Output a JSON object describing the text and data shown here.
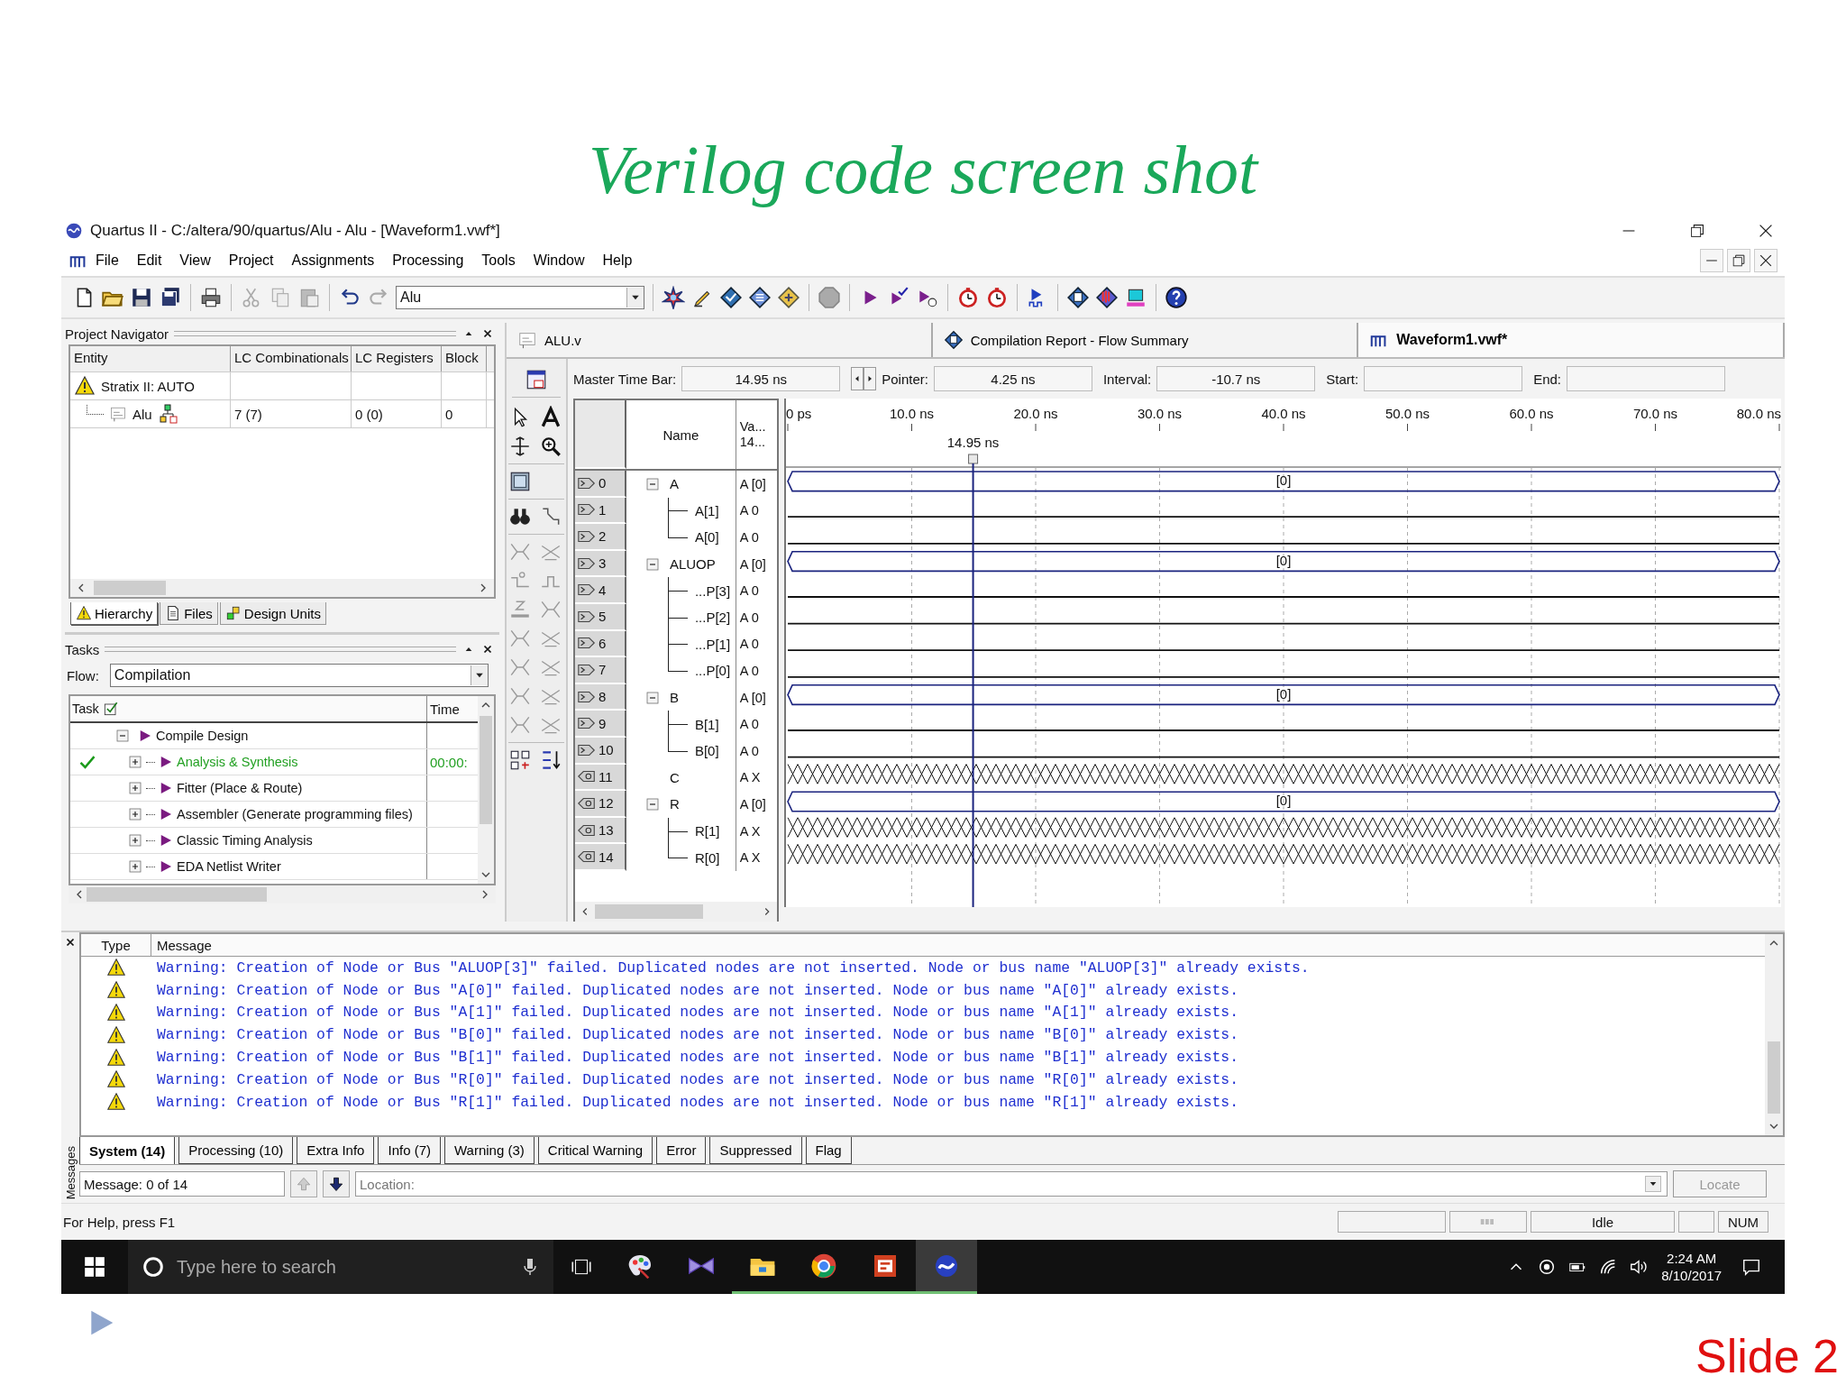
{
  "slide": {
    "title": "Verilog code screen shot",
    "footer": "Slide 2"
  },
  "window": {
    "title": "Quartus II - C:/altera/90/quartus/Alu - Alu - [Waveform1.vwf*]"
  },
  "menu": [
    "File",
    "Edit",
    "View",
    "Project",
    "Assignments",
    "Processing",
    "Tools",
    "Window",
    "Help"
  ],
  "toolbar": {
    "combo": "Alu"
  },
  "project_navigator": {
    "title": "Project Navigator",
    "columns": [
      "Entity",
      "LC Combinationals",
      "LC Registers",
      "Block"
    ],
    "rows": [
      {
        "entity": "Stratix II: AUTO",
        "kind": "device"
      },
      {
        "entity": "Alu",
        "kind": "module",
        "cells": [
          "7 (7)",
          "0 (0)",
          "0"
        ]
      }
    ],
    "tabs": [
      {
        "label": "Hierarchy",
        "kind": "hierarchy",
        "selected": true
      },
      {
        "label": "Files",
        "kind": "files",
        "selected": false
      },
      {
        "label": "Design Units",
        "kind": "units",
        "selected": false
      }
    ]
  },
  "tasks": {
    "title": "Tasks",
    "flow_label": "Flow:",
    "flow": "Compilation",
    "columns": [
      "Task",
      "Time"
    ],
    "items": [
      {
        "label": "Compile Design",
        "expanded": true,
        "children": [
          {
            "label": "Analysis & Synthesis",
            "done": true,
            "time": "00:00:",
            "expanded": false
          },
          {
            "label": "Fitter (Place & Route)",
            "done": false,
            "expanded": false
          },
          {
            "label": "Assembler (Generate programming files)",
            "done": false,
            "expanded": false
          },
          {
            "label": "Classic Timing Analysis",
            "done": false,
            "expanded": false
          },
          {
            "label": "EDA Netlist Writer",
            "done": false,
            "expanded": false
          }
        ]
      }
    ]
  },
  "doc_tabs": [
    {
      "label": "ALU.v",
      "kind": "verilog",
      "selected": false
    },
    {
      "label": "Compilation Report - Flow Summary",
      "kind": "report",
      "selected": false
    },
    {
      "label": "Waveform1.vwf*",
      "kind": "waveform",
      "selected": true
    }
  ],
  "time_bar": [
    {
      "label": "Master Time Bar:",
      "value": "14.95 ns",
      "arrows": true
    },
    {
      "label": "Pointer:",
      "value": "4.25 ns"
    },
    {
      "label": "Interval:",
      "value": "-10.7 ns"
    },
    {
      "label": "Start:"
    },
    {
      "label": "End:"
    }
  ],
  "waveform": {
    "name_header": "Name",
    "value_header": [
      "Va...",
      "14..."
    ],
    "ticks": [
      "0 ps",
      "10.0 ns",
      "20.0 ns",
      "30.0 ns",
      "40.0 ns",
      "50.0 ns",
      "60.0 ns",
      "70.0 ns",
      "80.0 ns"
    ],
    "cursor": "14.95 ns",
    "signals": [
      {
        "index": "0",
        "name": "A",
        "value": "A [0]",
        "kind": "input_bus",
        "wave_label": "[0]",
        "expanded": true,
        "children": [
          {
            "index": "1",
            "name": "A[1]",
            "value": "A 0",
            "kind": "input_low"
          },
          {
            "index": "2",
            "name": "A[0]",
            "value": "A 0",
            "kind": "input_low"
          }
        ]
      },
      {
        "index": "3",
        "name": "ALUOP",
        "value": "A [0]",
        "kind": "input_bus",
        "wave_label": "[0]",
        "expanded": true,
        "children": [
          {
            "index": "4",
            "name": "...P[3]",
            "value": "A 0",
            "kind": "input_low"
          },
          {
            "index": "5",
            "name": "...P[2]",
            "value": "A 0",
            "kind": "input_low"
          },
          {
            "index": "6",
            "name": "...P[1]",
            "value": "A 0",
            "kind": "input_low"
          },
          {
            "index": "7",
            "name": "...P[0]",
            "value": "A 0",
            "kind": "input_low"
          }
        ]
      },
      {
        "index": "8",
        "name": "B",
        "value": "A [0]",
        "kind": "input_bus",
        "wave_label": "[0]",
        "expanded": true,
        "children": [
          {
            "index": "9",
            "name": "B[1]",
            "value": "A 0",
            "kind": "input_low"
          },
          {
            "index": "10",
            "name": "B[0]",
            "value": "A 0",
            "kind": "input_low"
          }
        ]
      },
      {
        "index": "11",
        "name": "C",
        "value": "A X",
        "kind": "output_unknown"
      },
      {
        "index": "12",
        "name": "R",
        "value": "A [0]",
        "kind": "output_bus",
        "wave_label": "[0]",
        "expanded": true,
        "children": [
          {
            "index": "13",
            "name": "R[1]",
            "value": "A X",
            "kind": "output_unknown"
          },
          {
            "index": "14",
            "name": "R[0]",
            "value": "A X",
            "kind": "output_unknown"
          }
        ]
      }
    ]
  },
  "messages": {
    "side_label": "Messages",
    "columns": [
      "Type",
      "Message"
    ],
    "rows": [
      {
        "kind": "warning",
        "text": "Warning: Creation of Node or Bus \"ALUOP[3]\" failed. Duplicated nodes are not inserted. Node or bus name \"ALUOP[3]\" already exists."
      },
      {
        "kind": "warning",
        "text": "Warning: Creation of Node or Bus \"A[0]\" failed. Duplicated nodes are not inserted. Node or bus name \"A[0]\" already exists."
      },
      {
        "kind": "warning",
        "text": "Warning: Creation of Node or Bus \"A[1]\" failed. Duplicated nodes are not inserted. Node or bus name \"A[1]\" already exists."
      },
      {
        "kind": "warning",
        "text": "Warning: Creation of Node or Bus \"B[0]\" failed. Duplicated nodes are not inserted. Node or bus name \"B[0]\" already exists."
      },
      {
        "kind": "warning",
        "text": "Warning: Creation of Node or Bus \"B[1]\" failed. Duplicated nodes are not inserted. Node or bus name \"B[1]\" already exists."
      },
      {
        "kind": "warning",
        "text": "Warning: Creation of Node or Bus \"R[0]\" failed. Duplicated nodes are not inserted. Node or bus name \"R[0]\" already exists."
      },
      {
        "kind": "warning",
        "text": "Warning: Creation of Node or Bus \"R[1]\" failed. Duplicated nodes are not inserted. Node or bus name \"R[1]\" already exists."
      }
    ],
    "tabs": [
      {
        "label": "System (14)",
        "selected": true
      },
      {
        "label": "Processing (10)",
        "selected": false
      },
      {
        "label": "Extra Info",
        "selected": false
      },
      {
        "label": "Info (7)",
        "selected": false
      },
      {
        "label": "Warning (3)",
        "selected": false
      },
      {
        "label": "Critical Warning",
        "selected": false
      },
      {
        "label": "Error",
        "selected": false
      },
      {
        "label": "Suppressed",
        "selected": false
      },
      {
        "label": "Flag",
        "selected": false
      }
    ],
    "counter": "Message: 0 of 14",
    "location_placeholder": "Location:",
    "locate": {
      "label": "Locate",
      "disabled": true
    }
  },
  "status_bar": {
    "help": "For Help, press F1",
    "state": "Idle",
    "num": "NUM"
  },
  "taskbar": {
    "search_placeholder": "Type here to search",
    "time": "2:24 AM",
    "date": "8/10/2017",
    "apps": [
      {
        "kind": "paint",
        "running": false,
        "selected": false
      },
      {
        "kind": "studio",
        "running": false,
        "selected": false
      },
      {
        "kind": "explorer",
        "running": true,
        "selected": false
      },
      {
        "kind": "browser",
        "running": true,
        "selected": false
      },
      {
        "kind": "reader",
        "running": true,
        "selected": false
      },
      {
        "kind": "quartus",
        "running": true,
        "selected": true
      }
    ]
  }
}
